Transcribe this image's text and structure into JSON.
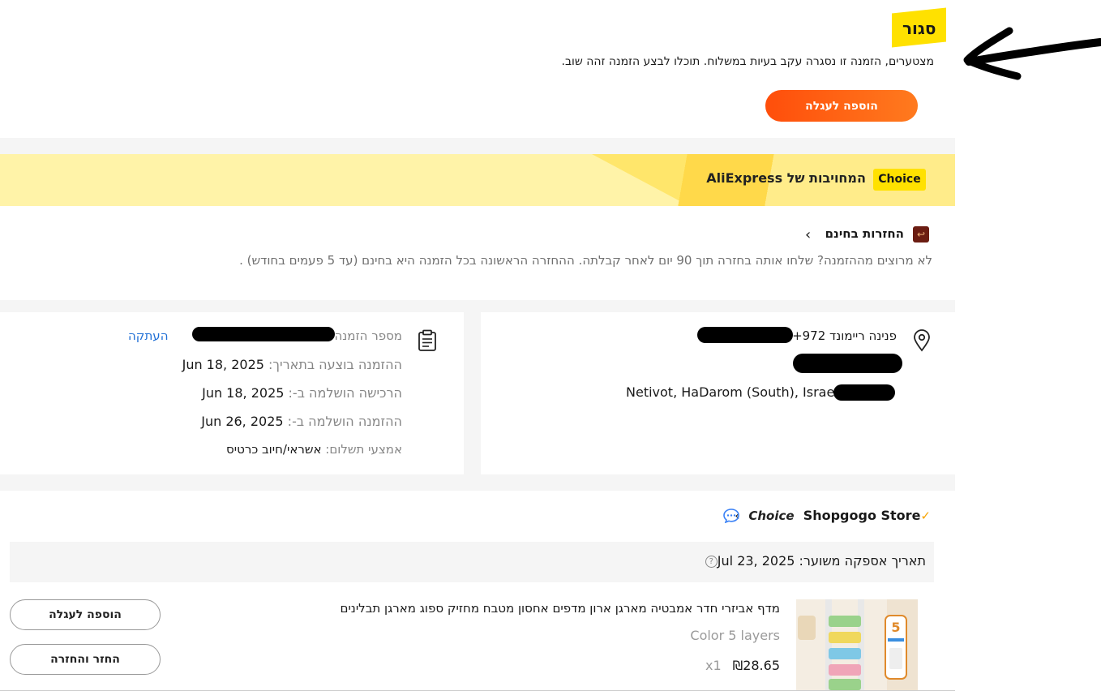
{
  "status": {
    "badge": "סגור",
    "message": "מצטערים, הזמנה זו נסגרה עקב בעיות במשלוח. תוכלו לבצע הזמנה זהה שוב.",
    "add_to_cart": "הוספה לעגלה"
  },
  "banner": {
    "tag": "Choice",
    "title": "המחויבות של AliExpress"
  },
  "returns": {
    "title": "החזרות בחינם",
    "text": "לא מרוצים מההזמנה? שלחו אותה בחזרה תוך 90 יום לאחר קבלתה. ההחזרה הראשונה בכל הזמנה היא בחינם (עד 5 פעמים בחודש) ."
  },
  "address": {
    "name": "פנינה ריימונד",
    "phone_prefix": "+972",
    "city_line": "Netivot, HaDarom (South), Israel,"
  },
  "order": {
    "number_label": "מספר הזמנה",
    "copy": "העתקה",
    "placed_label": "ההזמנה בוצעה בתאריך:",
    "placed_value": "Jun 18, 2025",
    "paid_label": "הרכישה הושלמה ב-:",
    "paid_value": "Jun 18, 2025",
    "completed_label": "ההזמנה הושלמה ב-:",
    "completed_value": "Jun 26, 2025",
    "payment_label": "אמצעי תשלום:",
    "payment_value": "אשראי/חיוב כרטיס"
  },
  "store": {
    "choice": "Choice",
    "name": "Shopgogo Store",
    "delivery_label": "תאריך אספקה משוער:",
    "delivery_value": "Jul 23, 2025"
  },
  "product": {
    "title": "מדף אביזרי חדר אמבטיה מארגן ארון מדפים אחסון מטבח מחזיק ספוג מארגן תבלינים",
    "variant": "Color 5 layers",
    "price": "₪28.65",
    "qty": "x1",
    "image_badge": "5",
    "add_to_cart": "הוספה לעגלה",
    "return_refund": "החזר והחזרה"
  },
  "colors": {
    "accent": "#ff4e0b",
    "badge_yellow": "#ffe100",
    "link": "#1f6fd6"
  }
}
